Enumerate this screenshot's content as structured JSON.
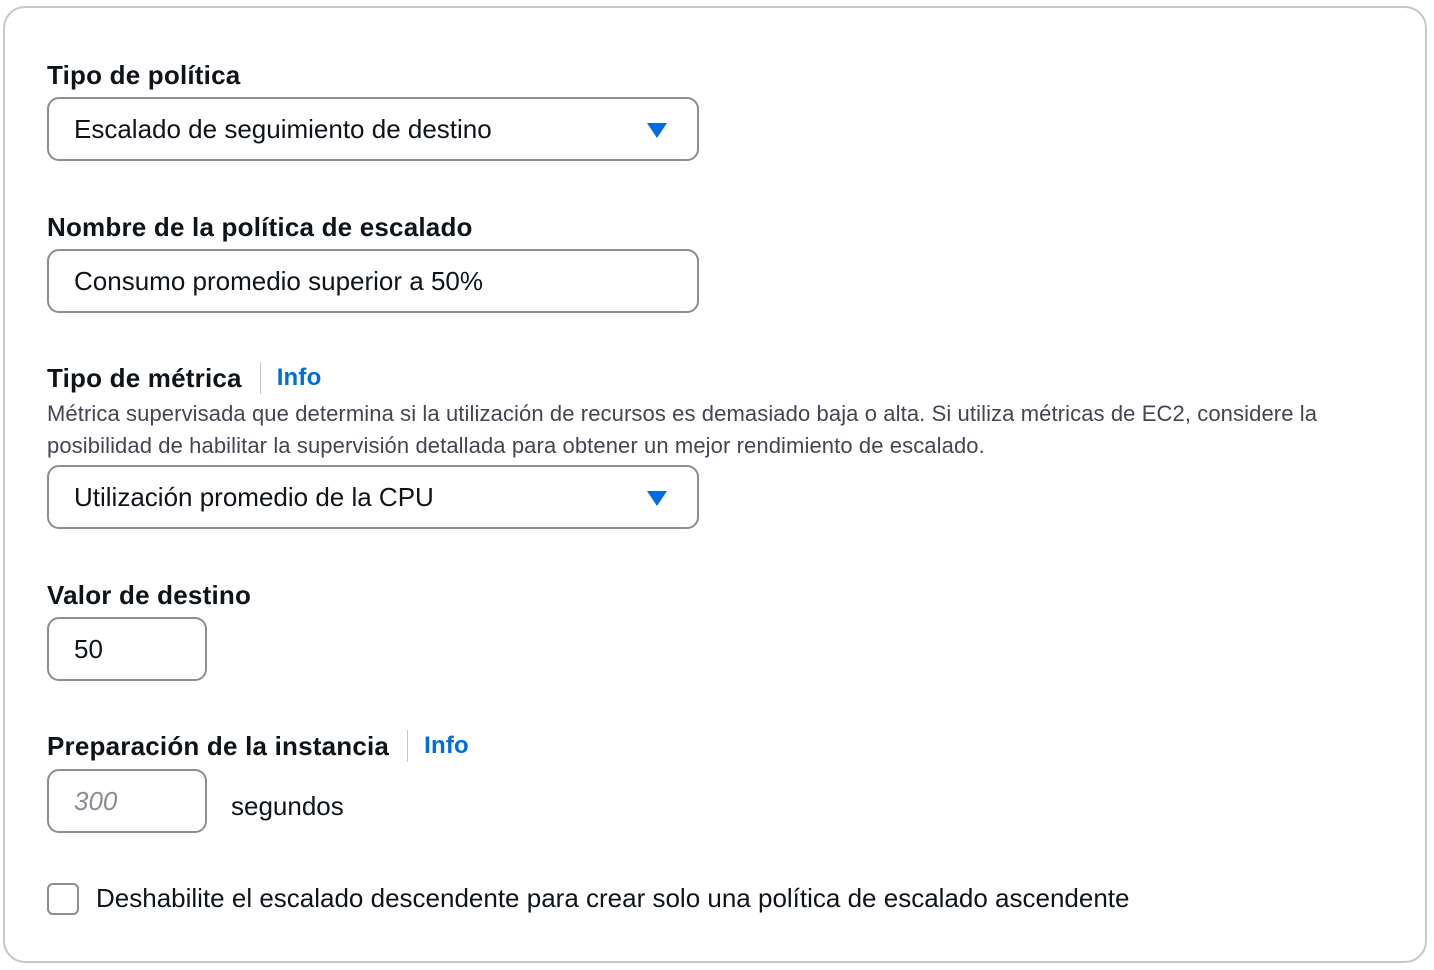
{
  "policy_type": {
    "label": "Tipo de política",
    "selected": "Escalado de seguimiento de destino"
  },
  "policy_name": {
    "label": "Nombre de la política de escalado",
    "value": "Consumo promedio superior a 50%"
  },
  "metric_type": {
    "label": "Tipo de métrica",
    "info": "Info",
    "description": "Métrica supervisada que determina si la utilización de recursos es demasiado baja o alta. Si utiliza métricas de EC2, considere la posibilidad de habilitar la supervisión detallada para obtener un mejor rendimiento de escalado.",
    "selected": "Utilización promedio de la CPU"
  },
  "target_value": {
    "label": "Valor de destino",
    "value": "50"
  },
  "instance_warmup": {
    "label": "Preparación de la instancia",
    "info": "Info",
    "placeholder": "300",
    "suffix": "segundos"
  },
  "disable_scale_in": {
    "label": "Deshabilite el escalado descendente para crear solo una política de escalado ascendente",
    "checked": false
  },
  "colors": {
    "accent": "#006ce0",
    "border": "#8c8c94",
    "panel_border": "#c6c6cd",
    "text": "#0f141a",
    "secondary_text": "#424650"
  },
  "icons": {
    "dropdown": "caret-down-icon"
  }
}
